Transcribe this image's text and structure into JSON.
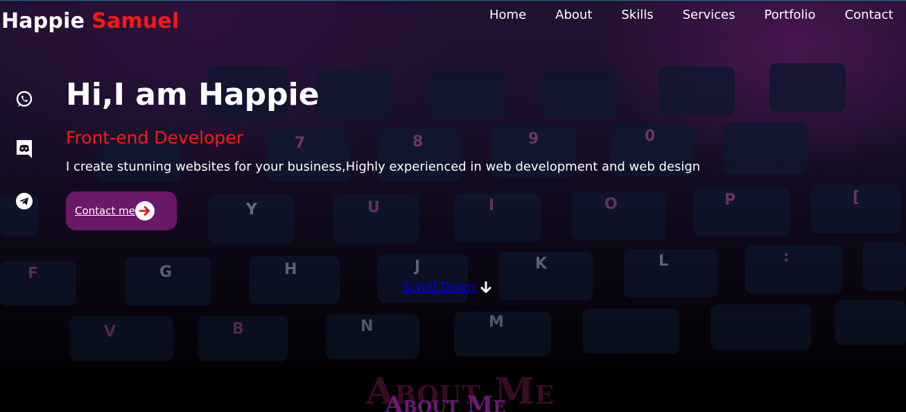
{
  "logo": {
    "first": "Happie",
    "last": "Samuel"
  },
  "nav": {
    "items": [
      "Home",
      "About",
      "Skills",
      "Services",
      "Portfolio",
      "Contact"
    ]
  },
  "social": [
    {
      "icon": "whatsapp-icon"
    },
    {
      "icon": "discord-icon"
    },
    {
      "icon": "telegram-icon"
    }
  ],
  "hero": {
    "headline": "Hi,I am Happie",
    "role": "Front-end Developer",
    "tagline": "I create stunning websites for your business,Highly experienced in web development and web design",
    "cta_label": "Contact me",
    "scroll_label": "Scroll Down"
  },
  "about": {
    "title": "About Me"
  },
  "colors": {
    "accent_red": "#ff1616",
    "button_purple": "#6a1868",
    "about_purple": "#6c1a78"
  }
}
